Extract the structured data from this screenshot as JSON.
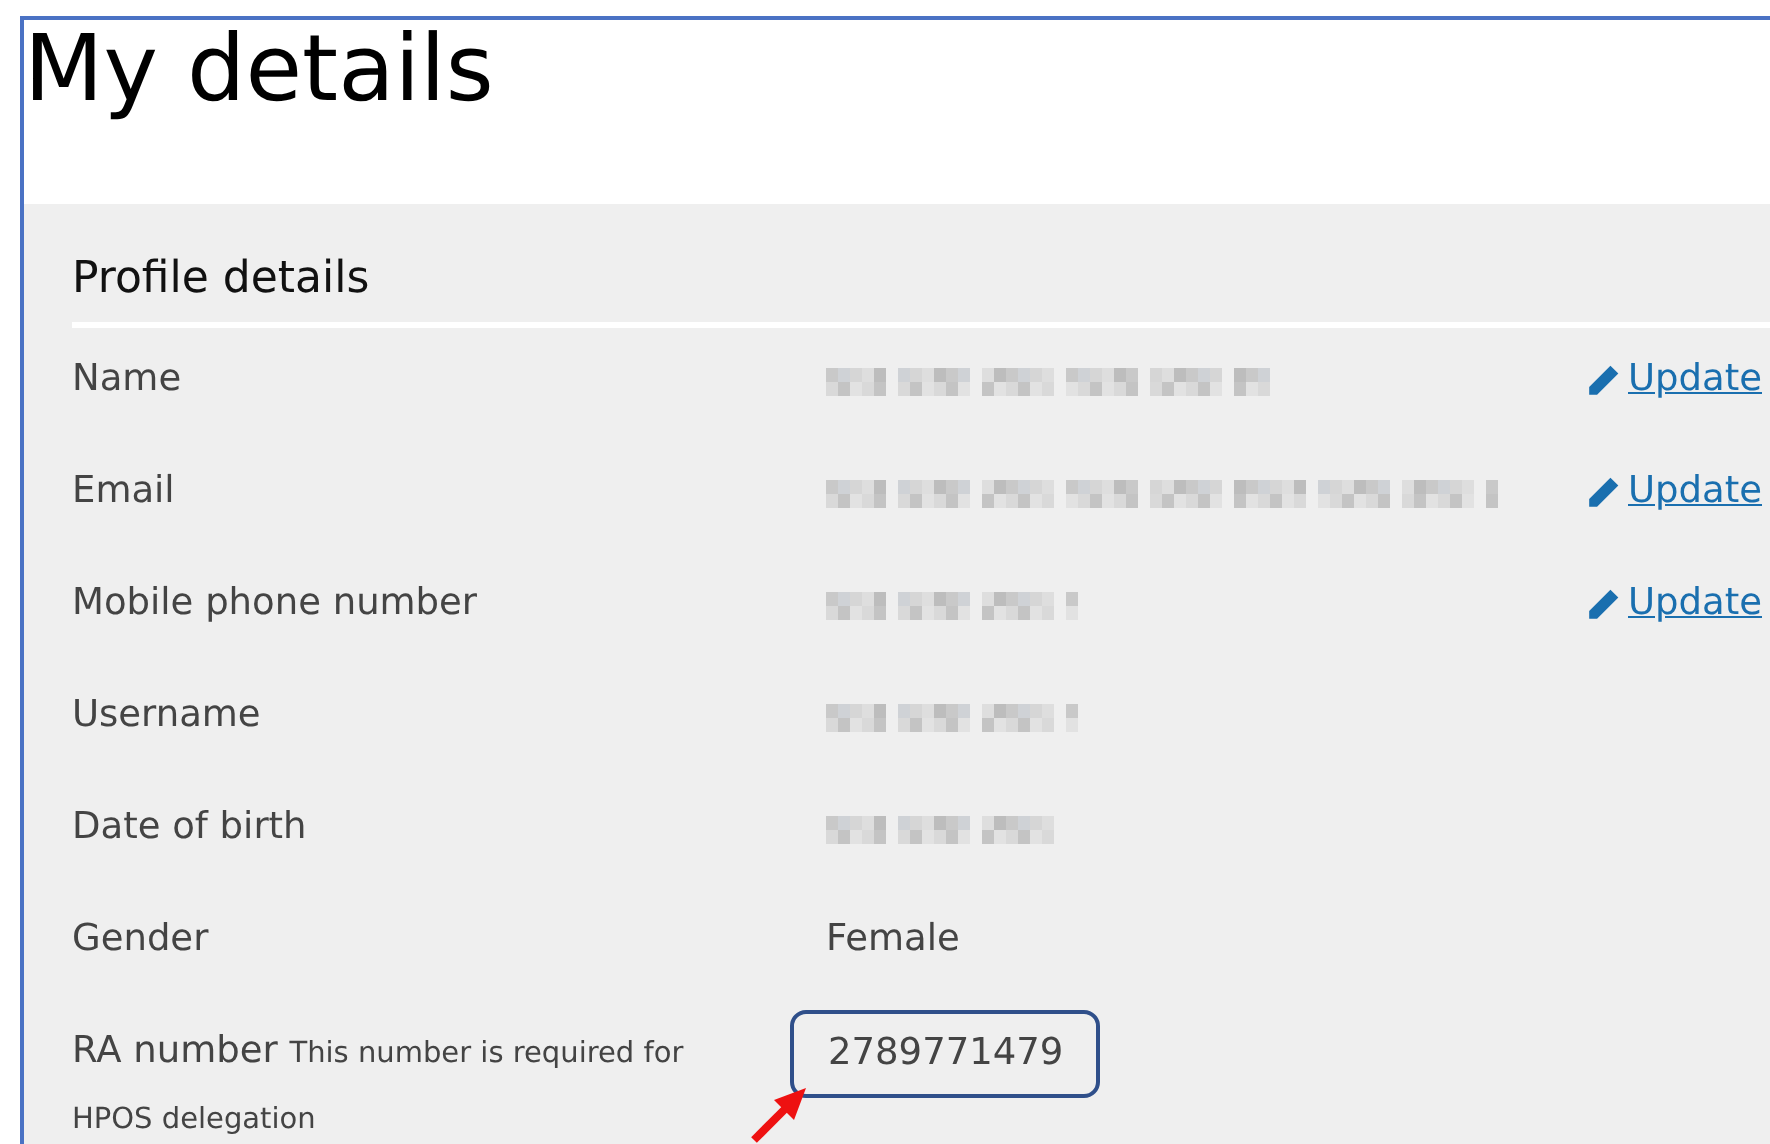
{
  "title": "My details",
  "section": {
    "heading": "Profile details",
    "rows": [
      {
        "label": "Name",
        "kind": "blurred",
        "action": "Update"
      },
      {
        "label": "Email",
        "kind": "blurred",
        "action": "Update"
      },
      {
        "label": "Mobile phone number",
        "kind": "blurred",
        "action": "Update"
      },
      {
        "label": "Username",
        "kind": "blurred"
      },
      {
        "label": "Date of birth",
        "kind": "blurred"
      },
      {
        "label": "Gender",
        "kind": "text",
        "value": "Female"
      },
      {
        "label": "RA number",
        "note": "This number is required for HPOS delegation",
        "kind": "highlighted",
        "value": "2789771479"
      }
    ]
  }
}
